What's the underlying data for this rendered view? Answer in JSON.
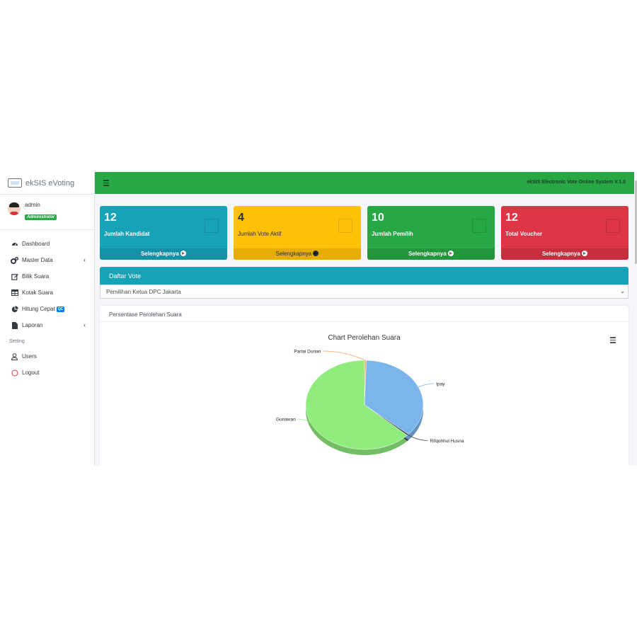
{
  "brand": {
    "name": "ekSIS eVoting"
  },
  "user": {
    "name": "admin",
    "role": "Administrator"
  },
  "sidebar": {
    "items": [
      {
        "label": "Dashboard",
        "icon": "dashboard-icon"
      },
      {
        "label": "Master Data",
        "icon": "gears-icon"
      },
      {
        "label": "Bilik Suara",
        "icon": "edit-icon"
      },
      {
        "label": "Kotak Suara",
        "icon": "table-icon"
      },
      {
        "label": "Hitung Cepat",
        "icon": "pie-chart-icon",
        "badge": "QC"
      },
      {
        "label": "Laporan",
        "icon": "file-icon"
      }
    ],
    "setting_header": "Setting",
    "setting_items": [
      {
        "label": "Users",
        "icon": "user-icon"
      },
      {
        "label": "Logout",
        "icon": "power-icon"
      }
    ]
  },
  "topbar": {
    "title": "ekSIS Electronic Vote Online System V.1.0"
  },
  "boxes": [
    {
      "value": "12",
      "label": "Jumlah Kandidat",
      "footer": "Selengkapnya",
      "color": "#17a2b8"
    },
    {
      "value": "4",
      "label": "Jumlah Vote Aktif",
      "footer": "Selengkapnya",
      "color": "#ffc107"
    },
    {
      "value": "10",
      "label": "Jumlah Pemilih",
      "footer": "Selengkapnya",
      "color": "#28a745"
    },
    {
      "value": "12",
      "label": "Total Voucher",
      "footer": "Selengkapnya",
      "color": "#dc3545"
    }
  ],
  "daftar_vote": {
    "title": "Daftar Vote",
    "selected": "Pemilihan Ketua DPC Jakarta"
  },
  "card": {
    "header": "Persentase Perolehan Suara"
  },
  "chart_data": {
    "type": "pie",
    "title": "Chart Perolehan Suara",
    "slices": [
      {
        "name": "Partai Durian",
        "value": 0.5,
        "color": "#f7a35c"
      },
      {
        "name": "Ipay",
        "value": 36,
        "color": "#7cb5ec"
      },
      {
        "name": "Rifqohhul Husna",
        "value": 0.5,
        "color": "#434348"
      },
      {
        "name": "Gunawan",
        "value": 63,
        "color": "#90ed7d"
      }
    ]
  }
}
